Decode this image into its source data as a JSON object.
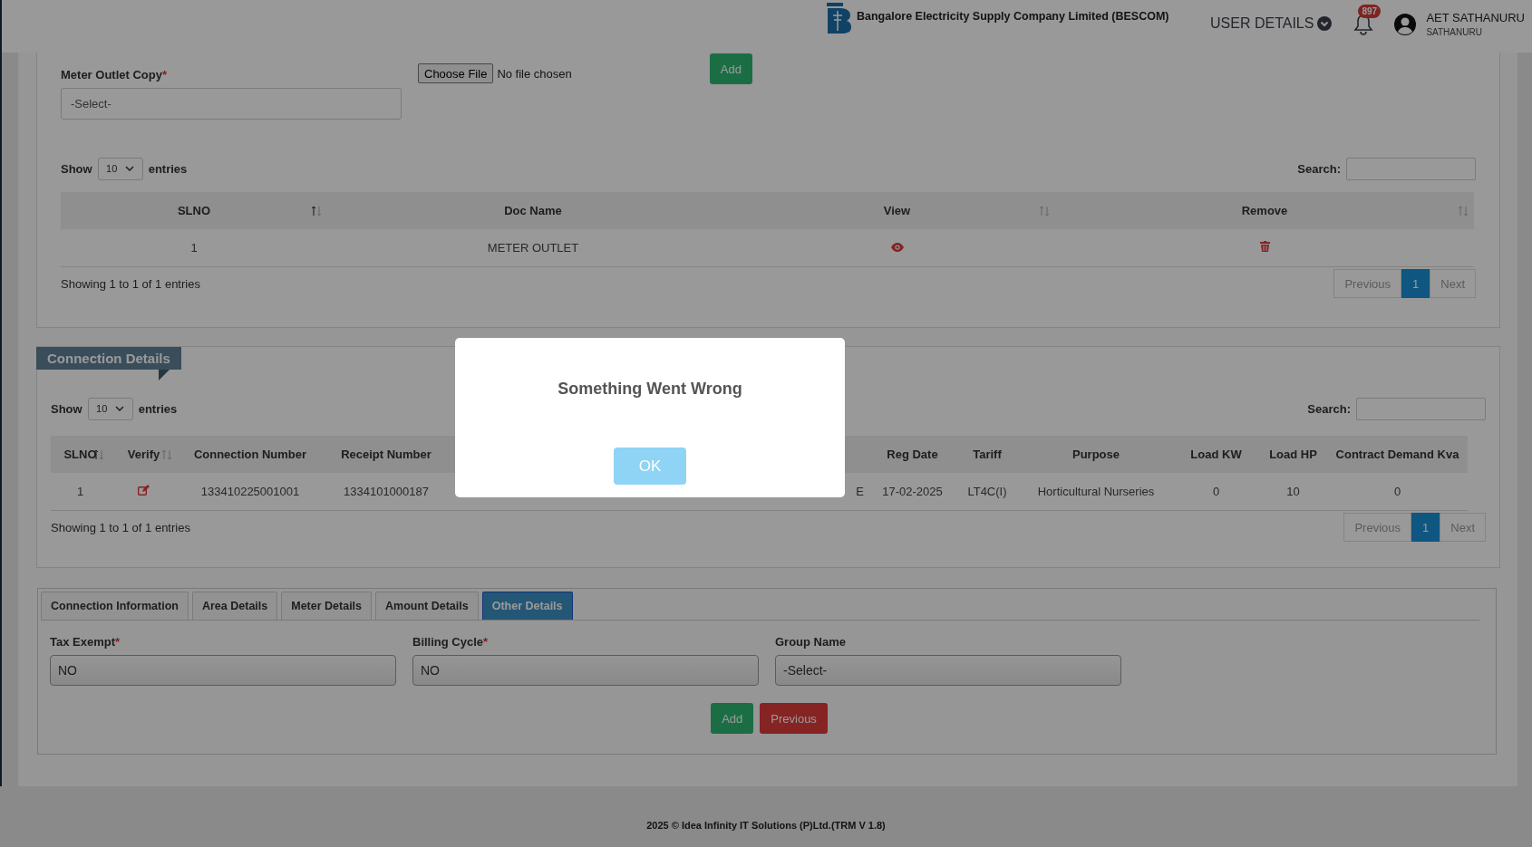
{
  "header": {
    "company": "Bangalore Electricity Supply Company Limited (BESCOM)",
    "user_menu": "USER DETAILS",
    "notification_count": "897",
    "user_name": "AET SATHANURU",
    "user_location": "SATHANURU"
  },
  "documents": {
    "field": {
      "label": "Meter Outlet Copy",
      "required_mark": "*",
      "value": "-Select-"
    },
    "file_button": "Choose File",
    "file_status": "No file chosen",
    "add_button": "Add",
    "table": {
      "show_label": "Show",
      "page_size": "10",
      "entries_label": "entries",
      "search_label": "Search:",
      "columns": [
        {
          "label": "SLNO",
          "sortable": true,
          "sorted": true
        },
        {
          "label": "Doc Name",
          "sortable": false
        },
        {
          "label": "View",
          "sortable": true,
          "sorted": false
        },
        {
          "label": "Remove",
          "sortable": true,
          "sorted": false
        }
      ],
      "rows": [
        [
          {
            "kind": "text",
            "text": "1"
          },
          {
            "kind": "text",
            "text": "METER OUTLET"
          },
          {
            "kind": "view"
          },
          {
            "kind": "remove"
          }
        ]
      ],
      "info": "Showing 1 to 1 of 1 entries",
      "pagination": [
        {
          "label": "Previous",
          "selected": false,
          "disabled": true
        },
        {
          "label": "1",
          "selected": true,
          "disabled": false
        },
        {
          "label": "Next",
          "selected": false,
          "disabled": true
        }
      ]
    }
  },
  "connection_details": {
    "title": "Connection Details",
    "table": {
      "show_label": "Show",
      "page_size": "10",
      "entries_label": "entries",
      "search_label": "Search:",
      "columns": [
        {
          "label": "SLNO",
          "sortable": true,
          "sorted": true
        },
        {
          "label": "Verify",
          "sortable": true,
          "sorted": false
        },
        {
          "label": "Connection Number",
          "sortable": false
        },
        {
          "label": "Receipt Number",
          "sortable": false
        },
        {
          "sortable": false
        },
        {
          "label": "Reg Date",
          "sortable": false
        },
        {
          "label": "Tariff",
          "sortable": false
        },
        {
          "label": "Purpose",
          "sortable": false
        },
        {
          "label": "Load KW",
          "sortable": false
        },
        {
          "label": "Load HP",
          "sortable": false
        },
        {
          "label": "Contract Demand Kva",
          "sortable": false
        }
      ],
      "rows": [
        [
          {
            "kind": "text",
            "text": "1"
          },
          {
            "kind": "edit"
          },
          {
            "kind": "text",
            "text": "133410225001001"
          },
          {
            "kind": "text",
            "text": "1334101000187"
          },
          {
            "kind": "text",
            "text": "E"
          },
          {
            "kind": "text",
            "text": "17-02-2025"
          },
          {
            "kind": "text",
            "text": "LT4C(I)"
          },
          {
            "kind": "text",
            "text": "Horticultural Nurseries"
          },
          {
            "kind": "text",
            "text": "0"
          },
          {
            "kind": "text",
            "text": "10"
          },
          {
            "kind": "text",
            "text": "0"
          }
        ]
      ],
      "info": "Showing 1 to 1 of 1 entries",
      "pagination": [
        {
          "label": "Previous",
          "selected": false,
          "disabled": true
        },
        {
          "label": "1",
          "selected": true,
          "disabled": false
        },
        {
          "label": "Next",
          "selected": false,
          "disabled": true
        }
      ]
    }
  },
  "detail_tabs": {
    "tabs": [
      {
        "label": "Connection Information",
        "selected": false
      },
      {
        "label": "Area Details",
        "selected": false
      },
      {
        "label": "Meter Details",
        "selected": false
      },
      {
        "label": "Amount Details",
        "selected": false
      },
      {
        "label": "Other Details",
        "selected": true
      }
    ],
    "fields": [
      {
        "label": "Tax Exempt",
        "required_mark": "*",
        "value": "NO"
      },
      {
        "label": "Billing Cycle",
        "required_mark": "*",
        "value": "NO"
      },
      {
        "label": "Group Name",
        "value": "-Select-"
      }
    ],
    "buttons": [
      {
        "label": "Add",
        "kind": "success"
      },
      {
        "label": "Previous",
        "kind": "danger"
      }
    ]
  },
  "footer": "2025 © Idea Infinity IT Solutions (P)Ltd.(TRM V 1.8)",
  "dialog": {
    "message": "Something Went Wrong",
    "button": "OK"
  }
}
